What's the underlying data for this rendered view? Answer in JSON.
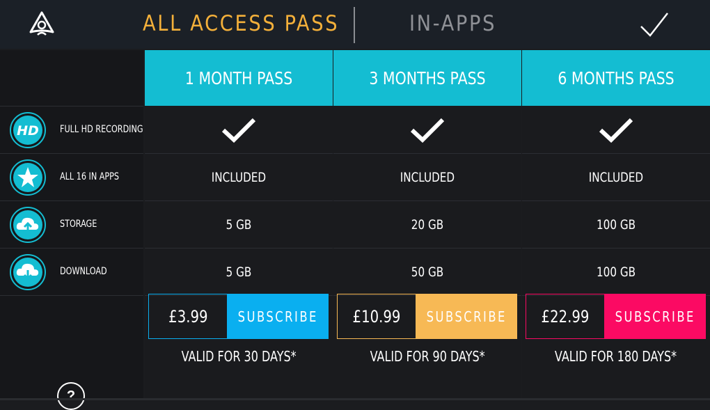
{
  "header": {
    "logo_icon": "logo-icon",
    "active_tab": "ALL ACCESS PASS",
    "inactive_tab": "IN-APPS",
    "confirm_icon": "checkmark-icon"
  },
  "colors": {
    "accent_header": "#14bdd2",
    "active_tab": "#f4b03a",
    "plan1_accent": "#0aaff0",
    "plan2_accent": "#f7b955",
    "plan3_accent": "#fb0a63"
  },
  "features": [
    {
      "label": "FULL HD RECORDING",
      "icon": "hd-icon"
    },
    {
      "label": "ALL 16 IN APPS",
      "icon": "star-icon"
    },
    {
      "label": "STORAGE",
      "icon": "cloud-upload-icon"
    },
    {
      "label": "DOWNLOAD",
      "icon": "cloud-download-icon"
    }
  ],
  "plans": [
    {
      "title": "1 MONTH PASS",
      "hd": "check-icon",
      "apps": "INCLUDED",
      "storage": "5 GB",
      "download": "5 GB",
      "price": "£3.99",
      "subscribe": "SUBSCRIBE",
      "valid": "VALID FOR 30 DAYS*"
    },
    {
      "title": "3 MONTHS PASS",
      "hd": "check-icon",
      "apps": "INCLUDED",
      "storage": "20 GB",
      "download": "50 GB",
      "price": "£10.99",
      "subscribe": "SUBSCRIBE",
      "valid": "VALID FOR 90 DAYS*"
    },
    {
      "title": "6 MONTHS PASS",
      "hd": "check-icon",
      "apps": "INCLUDED",
      "storage": "100 GB",
      "download": "100 GB",
      "price": "£22.99",
      "subscribe": "SUBSCRIBE",
      "valid": "VALID FOR 180 DAYS*"
    }
  ],
  "help": {
    "label": "?",
    "icon": "help-icon"
  }
}
